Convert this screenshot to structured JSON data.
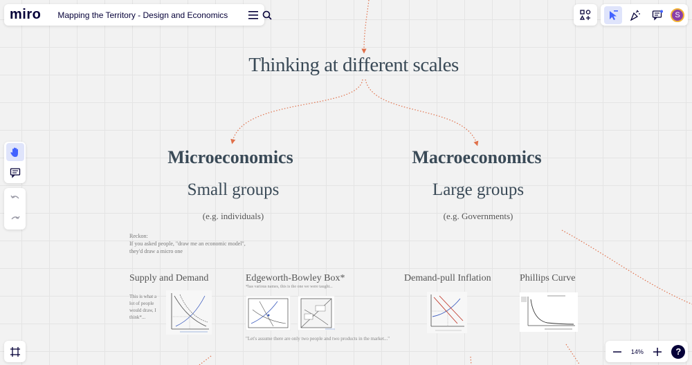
{
  "app": {
    "logo": "miro",
    "board_title": "Mapping the Territory - Design and Economics",
    "zoom": "14%",
    "help": "?",
    "avatar_initial": "S"
  },
  "board": {
    "main_heading": "Thinking at different scales",
    "micro": {
      "heading": "Microeconomics",
      "subheading": "Small groups",
      "example": "(e.g. individuals)"
    },
    "macro": {
      "heading": "Macroeconomics",
      "subheading": "Large groups",
      "example": "(e.g. Governments)"
    },
    "reckon": {
      "line1": "Reckon:",
      "line2": "If you asked people, \"draw me an economic model\",",
      "line3": "they'd draw a micro one"
    },
    "cards": {
      "supply_demand": {
        "title": "Supply and Demand",
        "note": "This is what a lot of people would draw, I think*..."
      },
      "edgeworth": {
        "title": "Edgeworth-Bowley Box*",
        "note": "*has various names, this is the one we were taught...",
        "bottom": "\"Let's assume there are only two people and two products in the market...\""
      },
      "demand_pull": {
        "title": "Demand-pull Inflation"
      },
      "phillips": {
        "title": "Phillips Curve"
      }
    }
  },
  "icons": {
    "menu": "hamburger-icon",
    "search": "search-icon",
    "shapes": "shapes-plus-icon",
    "select": "select-cursor-icon",
    "celebrate": "party-popper-icon",
    "comments": "comments-icon",
    "hand": "hand-icon",
    "comment": "comment-icon",
    "undo": "undo-icon",
    "redo": "redo-icon",
    "frames": "frames-icon",
    "zoom_out": "minus-icon",
    "zoom_in": "plus-icon"
  },
  "colors": {
    "accent": "#4262ff",
    "connector": "#e0704a",
    "heading": "#3a4a57"
  }
}
